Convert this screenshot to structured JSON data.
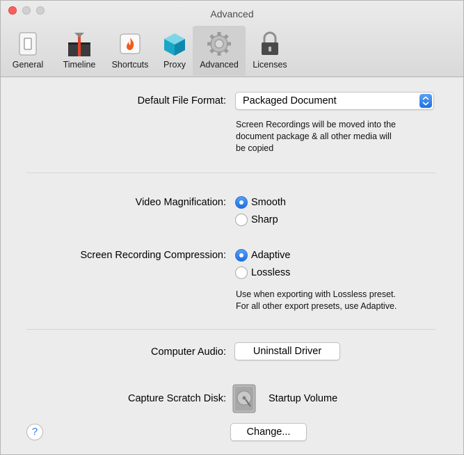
{
  "window": {
    "title": "Advanced"
  },
  "tabs": [
    {
      "label": "General",
      "icon": "general-switch-icon"
    },
    {
      "label": "Timeline",
      "icon": "timeline-icon"
    },
    {
      "label": "Shortcuts",
      "icon": "shortcuts-flame-icon"
    },
    {
      "label": "Proxy",
      "icon": "proxy-cube-icon"
    },
    {
      "label": "Advanced",
      "icon": "advanced-gear-icon",
      "selected": true
    },
    {
      "label": "Licenses",
      "icon": "licenses-lock-icon"
    }
  ],
  "default_file_format": {
    "label": "Default File Format:",
    "value": "Packaged Document",
    "note": [
      "Screen Recordings will be moved into the",
      "document package & all other media will",
      "be copied"
    ]
  },
  "video_magnification": {
    "label": "Video Magnification:",
    "options": [
      {
        "label": "Smooth",
        "selected": true
      },
      {
        "label": "Sharp",
        "selected": false
      }
    ]
  },
  "screen_recording_compression": {
    "label": "Screen Recording Compression:",
    "options": [
      {
        "label": "Adaptive",
        "selected": true
      },
      {
        "label": "Lossless",
        "selected": false
      }
    ],
    "note": [
      "Use when exporting with Lossless preset.",
      "For all other export presets, use Adaptive."
    ]
  },
  "computer_audio": {
    "label": "Computer Audio:",
    "button": "Uninstall Driver"
  },
  "capture_scratch_disk": {
    "label": "Capture Scratch Disk:",
    "disk_name": "Startup Volume",
    "button": "Change..."
  },
  "help": {
    "glyph": "?"
  },
  "colors": {
    "accent": "#1f6fe0",
    "close": "#fc605c"
  }
}
